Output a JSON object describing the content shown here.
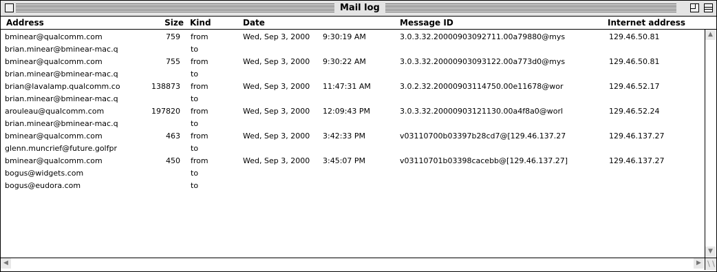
{
  "window": {
    "title": "Mail log"
  },
  "columns": {
    "address": "Address",
    "size": "Size",
    "kind": "Kind",
    "date": "Date",
    "message_id": "Message ID",
    "internet_address": "Internet address"
  },
  "rows": [
    {
      "address": "bminear@qualcomm.com",
      "size": "759",
      "kind": "from",
      "date": "Wed, Sep 3, 2000",
      "time": "9:30:19 AM",
      "message_id": "3.0.3.32.20000903092711.00a79880@mys",
      "ip": "129.46.50.81"
    },
    {
      "address": "brian.minear@bminear-mac.q",
      "size": "",
      "kind": "to",
      "date": "",
      "time": "",
      "message_id": "",
      "ip": ""
    },
    {
      "address": "bminear@qualcomm.com",
      "size": "755",
      "kind": "from",
      "date": "Wed, Sep 3, 2000",
      "time": "9:30:22 AM",
      "message_id": "3.0.3.32.20000903093122.00a773d0@mys",
      "ip": "129.46.50.81"
    },
    {
      "address": "brian.minear@bminear-mac.q",
      "size": "",
      "kind": "to",
      "date": "",
      "time": "",
      "message_id": "",
      "ip": ""
    },
    {
      "address": "brian@lavalamp.qualcomm.co",
      "size": "138873",
      "kind": "from",
      "date": "Wed, Sep 3, 2000",
      "time": "11:47:31 AM",
      "message_id": "3.0.2.32.20000903114750.00e11678@wor",
      "ip": "129.46.52.17"
    },
    {
      "address": "brian.minear@bminear-mac.q",
      "size": "",
      "kind": "to",
      "date": "",
      "time": "",
      "message_id": "",
      "ip": ""
    },
    {
      "address": "arouleau@qualcomm.com",
      "size": "197820",
      "kind": "from",
      "date": "Wed, Sep 3, 2000",
      "time": "12:09:43 PM",
      "message_id": "3.0.3.32.20000903121130.00a4f8a0@worl",
      "ip": "129.46.52.24"
    },
    {
      "address": "brian.minear@bminear-mac.q",
      "size": "",
      "kind": "to",
      "date": "",
      "time": "",
      "message_id": "",
      "ip": ""
    },
    {
      "address": "bminear@qualcomm.com",
      "size": "463",
      "kind": "from",
      "date": "Wed, Sep 3, 2000",
      "time": "3:42:33 PM",
      "message_id": "v03110700b03397b28cd7@[129.46.137.27",
      "ip": "129.46.137.27"
    },
    {
      "address": "glenn.muncrief@future.golfpr",
      "size": "",
      "kind": "to",
      "date": "",
      "time": "",
      "message_id": "",
      "ip": ""
    },
    {
      "address": "bminear@qualcomm.com",
      "size": "450",
      "kind": "from",
      "date": "Wed, Sep 3, 2000",
      "time": "3:45:07 PM",
      "message_id": "v03110701b03398cacebb@[129.46.137.27]",
      "ip": "129.46.137.27"
    },
    {
      "address": "bogus@widgets.com",
      "size": "",
      "kind": "to",
      "date": "",
      "time": "",
      "message_id": "",
      "ip": ""
    },
    {
      "address": "bogus@eudora.com",
      "size": "",
      "kind": "to",
      "date": "",
      "time": "",
      "message_id": "",
      "ip": ""
    }
  ],
  "icons": {
    "close": "close-box-icon",
    "zoom": "zoom-box-icon",
    "collapse": "collapse-box-icon",
    "scroll_up": "scroll-up-arrow-icon",
    "scroll_down": "scroll-down-arrow-icon",
    "scroll_left": "scroll-left-arrow-icon",
    "scroll_right": "scroll-right-arrow-icon",
    "grow": "grow-box-icon"
  },
  "colors": {
    "titlebar": "#e4e4e4",
    "border": "#000000"
  }
}
